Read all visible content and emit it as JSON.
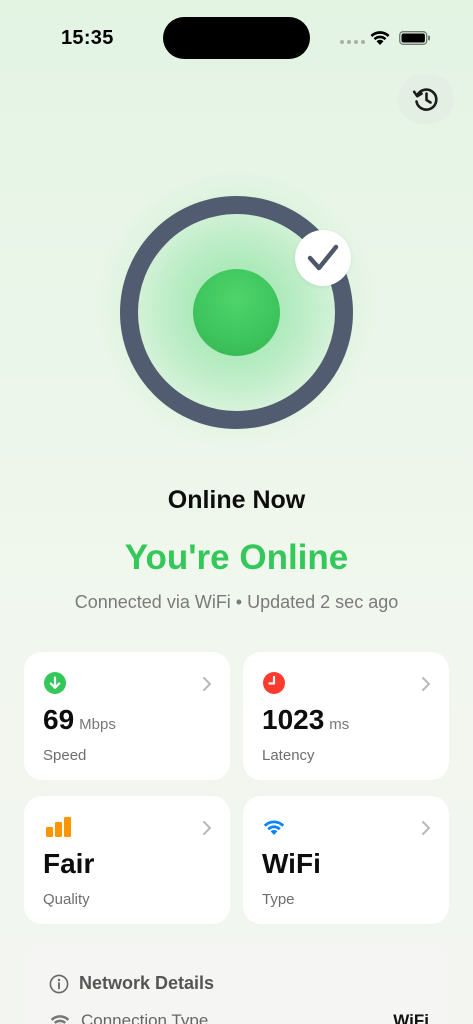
{
  "status_bar": {
    "time": "15:35"
  },
  "indicator": {
    "state": "online",
    "accent": "#34c759",
    "ring_color": "#525c70"
  },
  "status": {
    "title": "Online Now",
    "headline": "You're Online",
    "subtext": "Connected via WiFi • Updated 2 sec ago"
  },
  "cards": [
    {
      "icon": "download-icon",
      "value": "69",
      "unit": "Mbps",
      "label": "Speed",
      "icon_color": "#34c759"
    },
    {
      "icon": "clock-icon",
      "value": "1023",
      "unit": "ms",
      "label": "Latency",
      "icon_color": "#ff3b30"
    },
    {
      "icon": "signal-bars-icon",
      "value": "Fair",
      "unit": "",
      "label": "Quality",
      "icon_color": "#ff9500"
    },
    {
      "icon": "wifi-icon",
      "value": "WiFi",
      "unit": "",
      "label": "Type",
      "icon_color": "#0a84ff"
    }
  ],
  "details": {
    "title": "Network Details",
    "rows": [
      {
        "label": "Connection Type",
        "value": "WiFi"
      }
    ]
  }
}
